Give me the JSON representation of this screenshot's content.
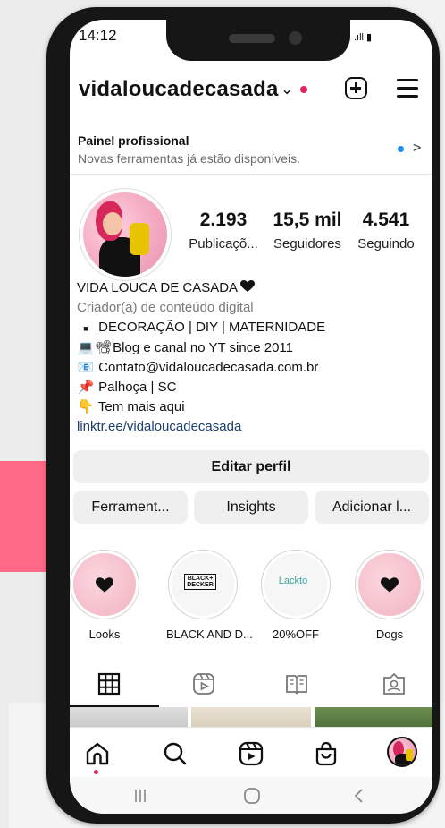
{
  "status_bar": {
    "time": "14:12",
    "signal_icons": ".ıll ▮"
  },
  "header": {
    "username": "vidaloucadecasada",
    "chevron": "⌄"
  },
  "panel": {
    "title": "Painel profissional",
    "subtitle": "Novas ferramentas já estão disponíveis."
  },
  "stats": [
    {
      "value": "2.193",
      "label": "Publicaçõ..."
    },
    {
      "value": "15,5 mil",
      "label": "Seguidores"
    },
    {
      "value": "4.541",
      "label": "Seguindo"
    }
  ],
  "bio": {
    "name": "VIDA LOUCA DE CASADA",
    "category": "Criador(a) de conteúdo digital",
    "line1": "DECORAÇÃO | DIY | MATERNIDADE",
    "line2": "Blog e canal no YT since 2011",
    "line3": "Contato@vidaloucadecasada.com.br",
    "line4": "Palhoça | SC",
    "line5": "Tem mais aqui",
    "link": "linktr.ee/vidaloucadecasada"
  },
  "buttons": {
    "edit_profile": "Editar perfil",
    "tools": "Ferrament...",
    "insights": "Insights",
    "add": "Adicionar l..."
  },
  "highlights": [
    {
      "label": "Looks"
    },
    {
      "label": "BLACK AND D...",
      "logo_line1": "BLACK+",
      "logo_line2": "DECKER"
    },
    {
      "label": "20%OFF",
      "logo": "Lackto"
    },
    {
      "label": "Dogs"
    }
  ],
  "colors": {
    "accent_pink": "#ff6a86",
    "notification_red": "#e0245e",
    "link_blue": "#1c3e70",
    "info_dot_blue": "#1a8cf0"
  }
}
